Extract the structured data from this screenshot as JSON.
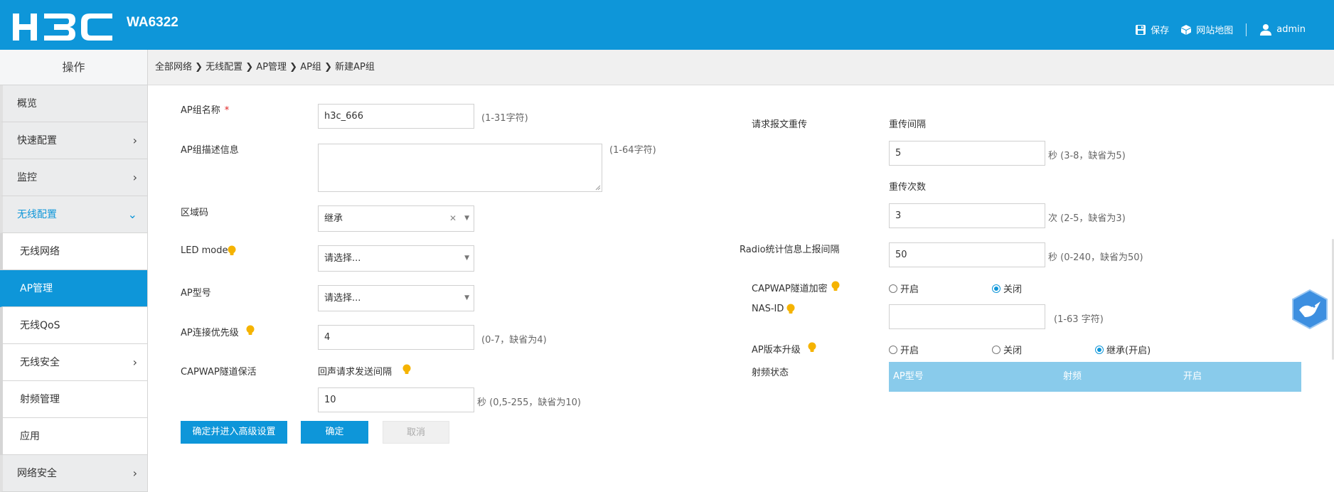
{
  "header": {
    "logo_text": "H3C",
    "model": "WA6322",
    "actions": [
      {
        "icon": "save-icon",
        "label": "保存"
      },
      {
        "icon": "sitemap-icon",
        "label": "网站地图"
      },
      {
        "icon": "user-icon",
        "label": "admin"
      }
    ]
  },
  "sidebar": {
    "title": "操作",
    "items": [
      {
        "label": "概览",
        "arrow": ""
      },
      {
        "label": "快速配置",
        "arrow": "›"
      },
      {
        "label": "监控",
        "arrow": "›"
      },
      {
        "label": "无线配置",
        "arrow": "⌄"
      },
      {
        "label": "无线网络",
        "arrow": ""
      },
      {
        "label": "AP管理",
        "arrow": ""
      },
      {
        "label": "无线QoS",
        "arrow": ""
      },
      {
        "label": "无线安全",
        "arrow": "›"
      },
      {
        "label": "射频管理",
        "arrow": ""
      },
      {
        "label": "应用",
        "arrow": ""
      },
      {
        "label": "网络安全",
        "arrow": "›"
      }
    ]
  },
  "breadcrumb": "全部网络 ❯ 无线配置 ❯ AP管理 ❯ AP组 ❯ 新建AP组",
  "form": {
    "group_name": {
      "label": "AP组名称",
      "required_mark": "*",
      "value": "h3c_666",
      "hint": "(1-31字符)"
    },
    "group_desc": {
      "label": "AP组描述信息",
      "value": "",
      "hint": "(1-64字符)"
    },
    "region_code": {
      "label": "区域码",
      "value": "继承"
    },
    "led_mode": {
      "label": "LED mode",
      "value": "请选择..."
    },
    "ap_model": {
      "label": "AP型号",
      "value": "请选择..."
    },
    "priority": {
      "label": "AP连接优先级",
      "value": "4",
      "hint": "(0-7，缺省为4)"
    },
    "keepalive": {
      "label": "CAPWAP隧道保活",
      "sub_label": "回声请求发送间隔",
      "value": "10",
      "hint": "秒 (0,5-255，缺省为10)"
    },
    "retrans": {
      "label": "请求报文重传",
      "interval_label": "重传间隔",
      "interval_value": "5",
      "interval_hint": "秒 (3-8，缺省为5)",
      "count_label": "重传次数",
      "count_value": "3",
      "count_hint": "次 (2-5，缺省为3)"
    },
    "radio_stats": {
      "label": "Radio统计信息上报间隔",
      "value": "50",
      "hint": "秒 (0-240，缺省为50)"
    },
    "capwap_encrypt": {
      "label": "CAPWAP隧道加密",
      "options": [
        "开启",
        "关闭"
      ],
      "selected": "关闭"
    },
    "nas_id": {
      "label": "NAS-ID",
      "value": "",
      "hint": "(1-63 字符)"
    },
    "ap_upgrade": {
      "label": "AP版本升级",
      "options": [
        "开启",
        "关闭",
        "继承(开启)"
      ],
      "selected": "继承(开启)"
    },
    "radio_state": {
      "label": "射频状态",
      "columns": [
        "AP型号",
        "射频",
        "开启"
      ]
    }
  },
  "buttons": {
    "advanced": "确定并进入高级设置",
    "ok": "确定",
    "cancel": "取消"
  },
  "colors": {
    "brand": "#0e96d9",
    "table_header": "#89cbeb",
    "required": "#e02020",
    "bulb": "#f5b301"
  }
}
